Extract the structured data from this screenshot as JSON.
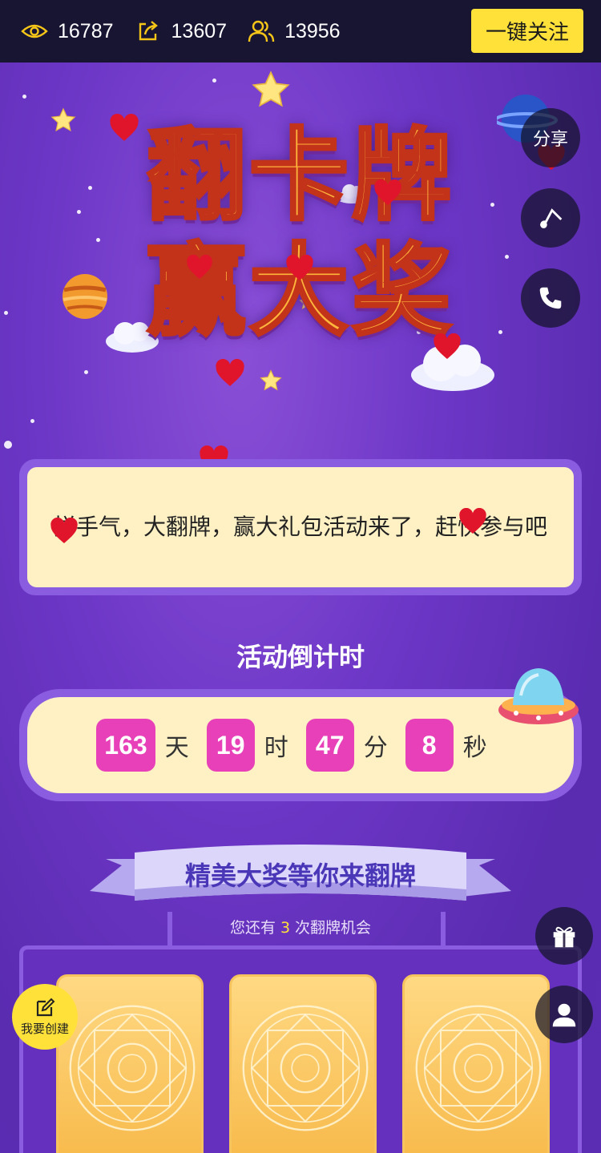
{
  "topbar": {
    "views": "16787",
    "shares": "13607",
    "participants": "13956",
    "follow_label": "一键关注"
  },
  "title": {
    "line1": "翻卡牌",
    "line2": "赢大奖"
  },
  "side": {
    "share_label": "分享"
  },
  "intro": {
    "text": "拼手气，大翻牌，赢大礼包活动来了，赶快参与吧"
  },
  "countdown": {
    "title": "活动倒计时",
    "days": "163",
    "days_unit": "天",
    "hours": "19",
    "hours_unit": "时",
    "minutes": "47",
    "minutes_unit": "分",
    "seconds": "8",
    "seconds_unit": "秒"
  },
  "prize": {
    "banner": "精美大奖等你来翻牌",
    "chances_prefix": "您还有",
    "chances_count": "3",
    "chances_suffix": "次翻牌机会"
  },
  "create": {
    "label": "我要创建"
  },
  "colors": {
    "accent_yellow": "#ffe13a",
    "countdown_pink": "#e840b8",
    "panel_cream": "#fff1c4",
    "bg_purple": "#6c36c6"
  }
}
